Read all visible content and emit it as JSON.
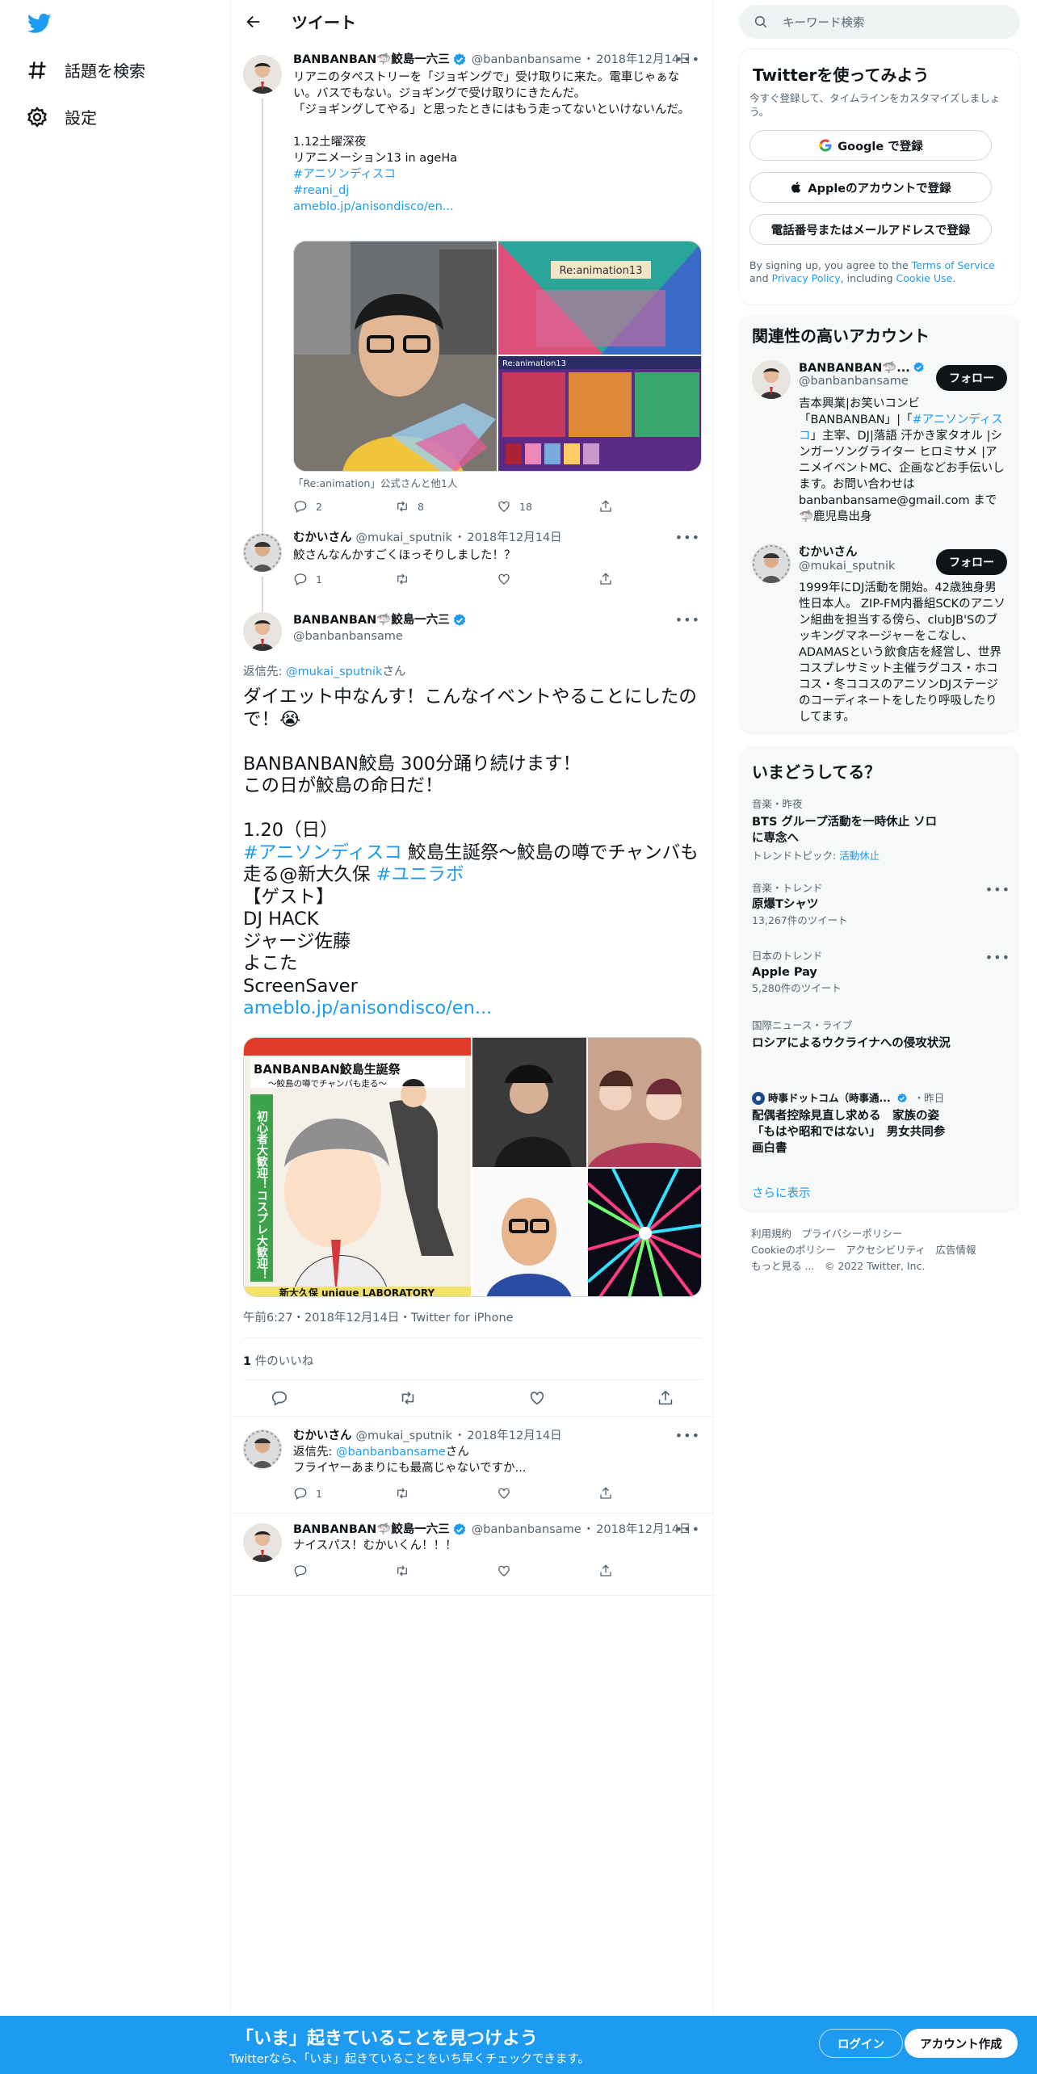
{
  "nav": {
    "explore_label": "話題を検索",
    "settings_label": "設定"
  },
  "header": {
    "title": "ツイート"
  },
  "tweet1": {
    "name": "BANBANBAN🦈鮫島一六三",
    "handle": "@banbanbansame",
    "date": "2018年12月14日",
    "text": "リアニのタペストリーを「ジョギングで」受け取りに来た。電車じゃぁない。バスでもない。ジョギングで受け取りにきたんだ。\n「ジョギングしてやる」と思ったときにはもう走ってないといけないんだ。\n\n1.12土曜深夜\nリアニメーション13 in ageHa",
    "hashtag1": "#アニソンディスコ",
    "hashtag2": "#reani_dj",
    "link": "ameblo.jp/anisondisco/en...",
    "media_caption": "「Re:animation」公式さんと他1人",
    "replies": "2",
    "retweets": "8",
    "likes": "18"
  },
  "tweet2": {
    "name": "むかいさん",
    "handle": "@mukai_sputnik",
    "date": "2018年12月14日",
    "text": "鮫さんなんかすごくほっそりしました！？",
    "replies": "1"
  },
  "main_tweet": {
    "name": "BANBANBAN🦈鮫島一六三",
    "handle": "@banbanbansame",
    "reply_prefix": "返信先: ",
    "reply_to": "@mukai_sputnik",
    "reply_suffix": "さん",
    "text_a": "ダイエット中なんす！こんなイベントやることにしたので！😭\n\nBANBANBAN鮫島 300分踊り続けます！\nこの日が鮫島の命日だ！\n\n1.20（日）",
    "hashtag1": "#アニソンディスコ",
    "text_b": " 鮫島生誕祭〜鮫島の噂でチャンバも走る@新大久保 ",
    "hashtag2": "#ユニラボ",
    "text_c": "【ゲスト】\nDJ HACK\nジャージ佐藤\nよこた\nScreenSaver",
    "link": "ameblo.jp/anisondisco/en...",
    "poster_title": "BANBANBAN鮫島生誕祭",
    "poster_sub": "〜鮫島の噂でチャンバも走る〜",
    "poster_side": "初心者大歓迎！コスプレ大歓迎！",
    "poster_bottom": "新大久保 unique LABORATORY",
    "meta": "午前6:27・2018年12月14日・Twitter for iPhone",
    "likes_count": "1",
    "likes_label": " 件のいいね"
  },
  "reply1": {
    "name": "むかいさん",
    "handle": "@mukai_sputnik",
    "date": "2018年12月14日",
    "reply_prefix": "返信先: ",
    "reply_to": "@banbanbansame",
    "reply_suffix": "さん",
    "text": "フライヤーあまりにも最高じゃないですか...",
    "replies": "1"
  },
  "reply2": {
    "name": "BANBANBAN🦈鮫島一六三",
    "handle": "@banbanbansame",
    "date": "2018年12月14日",
    "text": "ナイスパス！むかいくん！！！"
  },
  "search": {
    "placeholder": "キーワード検索"
  },
  "signup_card": {
    "title": "Twitterを使ってみよう",
    "subtitle": "今すぐ登録して、タイムラインをカスタマイズしましょう。",
    "google": "Google で登録",
    "apple": "Appleのアカウントで登録",
    "phone": "電話番号またはメールアドレスで登録",
    "terms_a": "By signing up, you agree to the ",
    "terms_link": "Terms of Service",
    "terms_b": " and ",
    "privacy_link": "Privacy Policy",
    "terms_c": ", including ",
    "cookie_link": "Cookie Use",
    "terms_d": "."
  },
  "related": {
    "title": "関連性の高いアカウント",
    "follow": "フォロー",
    "acc1": {
      "name": "BANBANBAN🦈...",
      "handle": "@banbanbansame",
      "bio_a": "吉本興業|お笑いコンビ「BANBANBAN」|「",
      "bio_tag": "#アニソンディスコ",
      "bio_b": "」主宰、DJ|落語 汗かき家タオル |シンガーソングライター ヒロミサメ |アニメイベントMC、企画などお手伝いします。お問い合わせは banbanbansame@gmail.com まで🦈鹿児島出身"
    },
    "acc2": {
      "name": "むかいさん",
      "handle": "@mukai_sputnik",
      "bio": "1999年にDJ活動を開始。42歳独身男性日本人。 ZIP-FM内番組SCKのアニソン組曲を担当する傍ら、clubJB'Sのブッキングマネージャーをこなし、ADAMASという飲食店を経営し、世界コスプレサミット主催ラグコス・ホココス・冬ココスのアニソンDJステージのコーディネートをしたり呼吸したりしてます。"
    }
  },
  "trends": {
    "title": "いまどうしてる？",
    "items": [
      {
        "ctx": "音楽・昨夜",
        "title": "BTS グループ活動を一時休止 ソロに専念へ",
        "sub_prefix": "トレンドトピック: ",
        "sub_link": "活動休止"
      },
      {
        "ctx": "音楽・トレンド",
        "title": "原爆Tシャツ",
        "count": "13,267件のツイート"
      },
      {
        "ctx": "日本のトレンド",
        "title": "Apple Pay",
        "count": "5,280件のツイート"
      },
      {
        "ctx": "国際ニュース・ライブ",
        "title": "ロシアによるウクライナへの侵攻状況"
      },
      {
        "ctx_name": "時事ドットコム（時事通...",
        "ctx_time": "・昨日",
        "title": "配偶者控除見直し求める　家族の姿「もはや昭和ではない」　男女共同参画白書"
      }
    ],
    "show_more": "さらに表示"
  },
  "footer": {
    "line1": "利用規約　プライバシーポリシー",
    "line2": "Cookieのポリシー　アクセシビリティ　広告情報",
    "line3": "もっと見る ...　© 2022 Twitter, Inc."
  },
  "bottom_bar": {
    "title": "「いま」起きていることを見つけよう",
    "subtitle": "Twitterなら、「いま」起きていることをいち早くチェックできます。",
    "login": "ログイン",
    "signup": "アカウント作成"
  },
  "colors": {
    "accent": "#1d9bf0",
    "text": "#0f1419",
    "secondary": "#536471"
  }
}
